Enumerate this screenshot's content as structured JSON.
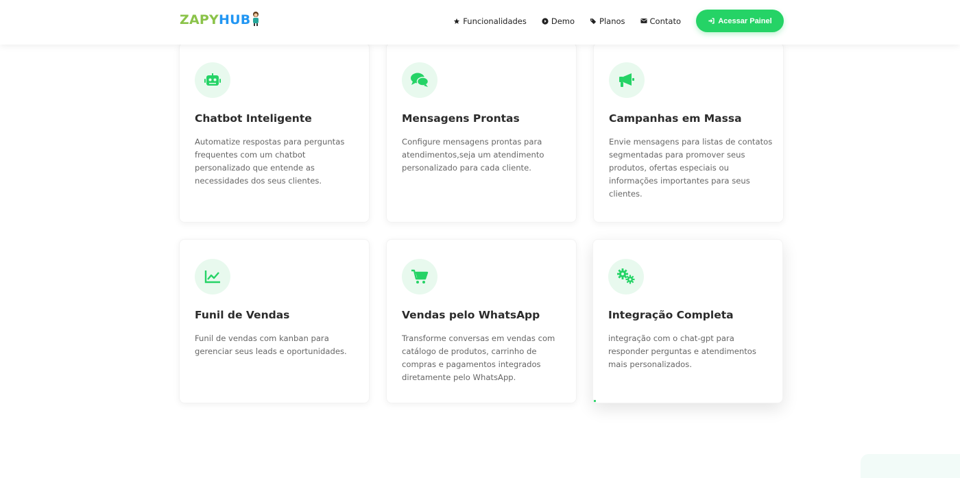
{
  "brand": {
    "part1": "ZAPY",
    "part2": "HUB",
    "color1": "#8bc34a",
    "color2": "#2196f3"
  },
  "nav": {
    "links": [
      {
        "label": "Funcionalidades",
        "icon": "star-icon"
      },
      {
        "label": "Demo",
        "icon": "play-circle-icon"
      },
      {
        "label": "Planos",
        "icon": "tags-icon"
      },
      {
        "label": "Contato",
        "icon": "envelope-icon"
      }
    ],
    "cta_label": "Acessar Painel",
    "cta_icon": "sign-in-icon"
  },
  "colors": {
    "accent": "#25d366",
    "icon_bg": "#e8f9ee"
  },
  "features": [
    {
      "title": "Chatbot Inteligente",
      "icon": "robot-icon",
      "desc": "Automatize respostas para perguntas frequentes com um chatbot personalizado que entende as necessidades dos seus clientes."
    },
    {
      "title": "Mensagens Prontas",
      "icon": "comments-icon",
      "desc": "Configure mensagens prontas para atendimentos,seja um atendimento personalizado para cada cliente."
    },
    {
      "title": "Campanhas em Massa",
      "icon": "megaphone-icon",
      "desc": "Envie mensagens para listas de contatos segmentadas para promover seus produtos, ofertas especiais ou informações importantes para seus clientes."
    },
    {
      "title": "Funil de Vendas",
      "icon": "line-chart-icon",
      "desc": "Funil de vendas com kanban para gerenciar seus leads e oportunidades."
    },
    {
      "title": "Vendas pelo WhatsApp",
      "icon": "shopping-cart-icon",
      "desc": "Transforme conversas em vendas com catálogo de produtos, carrinho de compras e pagamentos integrados diretamente pelo WhatsApp."
    },
    {
      "title": "Integração Completa",
      "icon": "cogs-icon",
      "desc": "integração com o chat-gpt para responder perguntas e atendimentos mais personalizados."
    }
  ]
}
